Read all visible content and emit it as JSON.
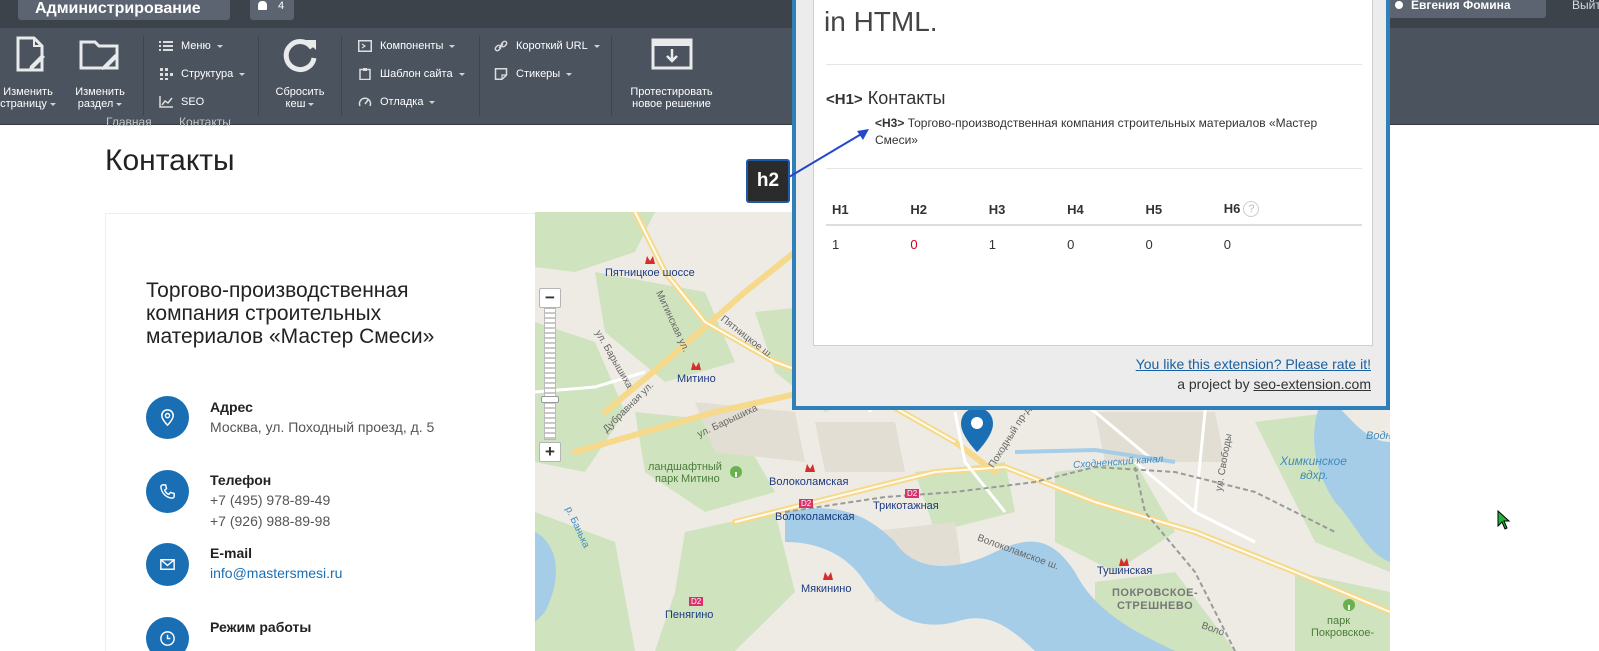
{
  "admin": {
    "title": "Администрирование",
    "notifications": "4",
    "user": "Евгения Фомина",
    "logout": "Выйти",
    "buttons": {
      "edit_page": [
        "Изменить",
        "страницу"
      ],
      "edit_section": [
        "Изменить",
        "раздел"
      ],
      "reset_cache": [
        "Сбросить",
        "кеш"
      ],
      "test_solution": [
        "Протестировать",
        "новое решение"
      ]
    },
    "menu": {
      "menu": "Меню",
      "structure": "Структура",
      "seo": "SEO",
      "components": "Компоненты",
      "site_template": "Шаблон сайта",
      "debug": "Отладка",
      "short_url": "Короткий URL",
      "stickers": "Стикеры"
    }
  },
  "breadcrumb": [
    "Главная",
    "Контакты"
  ],
  "page": {
    "title": "Контакты",
    "company": "Торгово-производственная компания строительных материалов «Мастер Смеси»",
    "contacts": {
      "address_label": "Адрес",
      "address_value": "Москва, ул. Походный проезд, д. 5",
      "phone_label": "Телефон",
      "phone_1": "+7 (495) 978-89-49",
      "phone_2": "+7 (926) 988-89-98",
      "email_label": "E-mail",
      "email_value": "info@mastersmesi.ru",
      "hours_label": "Режим работы"
    }
  },
  "map": {
    "labels": {
      "pyatnitskoe": "Пятницкое шоссе",
      "mitino": "Митино",
      "park_mitino_1": "ландшафтный",
      "park_mitino_2": "парк Митино",
      "volokolamskaya_metro": "Волоколамская",
      "volokolamskaya_rail": "Волоколамская",
      "trikotazhnaya": "Трикотажная",
      "myakinino": "Мякинино",
      "penyagino": "Пенягино",
      "tushinskaya": "Тушинская",
      "pokrovskoe_1": "ПОКРОВСКОЕ-",
      "pokrovskoe_2": "СТРЕШНЕВО",
      "khimkinskoe_1": "Химкинское",
      "khimkinskoe_2": "вдхр.",
      "skhodnensky": "Сходненский канал",
      "vodn": "Водн",
      "park_pokr_1": "парк",
      "park_pokr_2": "Покровское-",
      "st_mitinskaya": "Митинская ул.",
      "st_barysh1": "ул. Барышиха",
      "st_barysh2": "ул. Барышиха",
      "st_dubravnaya": "Дубравная ул.",
      "st_pyatnitskoe_sh": "Пятницкое ш.",
      "st_pokhodny": "Походный пр-д",
      "st_volokolamskoe": "Волоколамское ш.",
      "st_svobody": "ул. Свободы",
      "st_banka": "р. Банька",
      "st_volo2": "Воло",
      "d2": "D2"
    },
    "zoom_in": "+",
    "zoom_out": "−"
  },
  "popup": {
    "intro": "in HTML.",
    "h1_tag": "<H1>",
    "h1_text": "Контакты",
    "h3_tag": "<H3>",
    "h3_text": "Торгово-производственная компания строительных материалов «Мастер Смеси»",
    "table": {
      "headers": [
        "H1",
        "H2",
        "H3",
        "H4",
        "H5",
        "H6"
      ],
      "values": [
        "1",
        "0",
        "1",
        "0",
        "0",
        "0"
      ],
      "help": "?"
    },
    "rate_link": "You like this extension? Please rate it!",
    "project_prefix": "a project by",
    "project_link": "seo-extension.com"
  },
  "annotation": {
    "label": "h2"
  },
  "colors": {
    "accent": "#1a6fb4",
    "popup_border": "#2f7fb8",
    "zero_red": "#d0021b",
    "admin_bg": "#4a535e"
  }
}
